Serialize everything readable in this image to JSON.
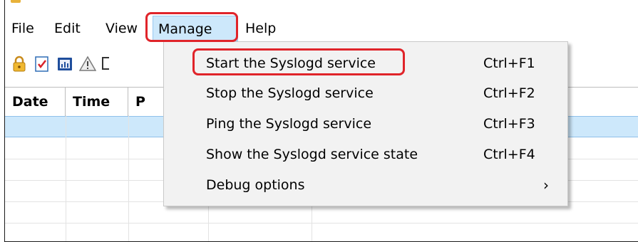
{
  "menubar": {
    "file": "File",
    "edit": "Edit",
    "view": "View",
    "manage": "Manage",
    "help": "Help"
  },
  "toolbar": {
    "icons": [
      "lock-icon",
      "checklist-icon",
      "chart-icon",
      "warning-icon"
    ]
  },
  "grid": {
    "columns": [
      "Date",
      "Time",
      "P"
    ]
  },
  "manage_menu": {
    "items": [
      {
        "label": "Start the Syslogd service",
        "shortcut": "Ctrl+F1"
      },
      {
        "label": "Stop the Syslogd service",
        "shortcut": "Ctrl+F2"
      },
      {
        "label": "Ping the Syslogd service",
        "shortcut": "Ctrl+F3"
      },
      {
        "label": "Show the Syslogd service state",
        "shortcut": "Ctrl+F4"
      },
      {
        "label": "Debug options",
        "submenu_arrow": "›"
      }
    ]
  },
  "colors": {
    "highlight": "#e0242a",
    "selection": "#cde8fb"
  }
}
